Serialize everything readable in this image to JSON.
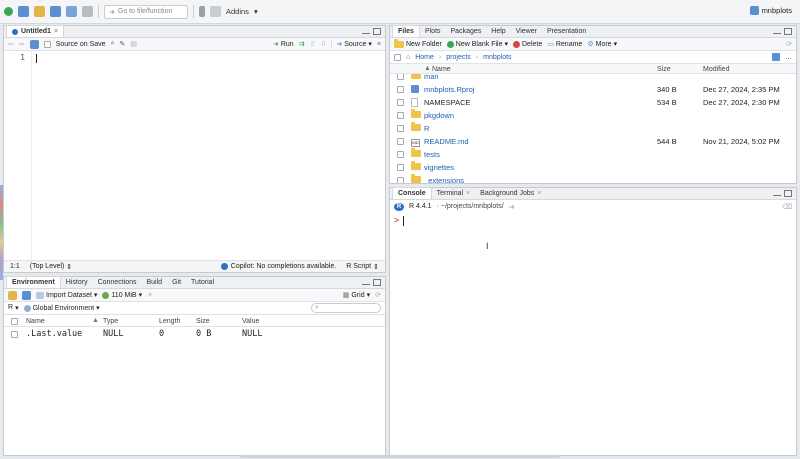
{
  "toolbar": {
    "goto_placeholder": "Go to file/function",
    "addins_label": "Addins",
    "project_label": "mnbplots"
  },
  "editor": {
    "tab_label": "Untitled1",
    "source_on_save_label": "Source on Save",
    "run_label": "Run",
    "source_label": "Source",
    "line_number": "1",
    "cursor_pos": "1:1",
    "scope": "(Top Level)",
    "copilot_status": "Copilot: No completions available.",
    "file_type": "R Script"
  },
  "env_pane": {
    "tabs": [
      "Environment",
      "History",
      "Connections",
      "Build",
      "Git",
      "Tutorial"
    ],
    "import_label": "Import Dataset",
    "memory_label": "110 MiB",
    "grid_label": "Grid",
    "lang_label": "R",
    "env_label": "Global Environment",
    "columns": [
      "Name",
      "Type",
      "Length",
      "Size",
      "Value"
    ],
    "rows": [
      {
        "name": ".Last.value",
        "type": "NULL",
        "length": "0",
        "size": "0 B",
        "value": "NULL"
      }
    ]
  },
  "files_pane": {
    "tabs": [
      "Files",
      "Plots",
      "Packages",
      "Help",
      "Viewer",
      "Presentation"
    ],
    "new_folder_label": "New Folder",
    "new_blank_file_label": "New Blank File",
    "delete_label": "Delete",
    "rename_label": "Rename",
    "more_label": "More",
    "breadcrumb": [
      "Home",
      "projects",
      "mnbplots"
    ],
    "columns": {
      "name": "Name",
      "size": "Size",
      "modified": "Modified"
    },
    "rows": [
      {
        "name": "man",
        "kind": "folder",
        "size": "",
        "modified": ""
      },
      {
        "name": "mnbplots.Rproj",
        "kind": "rproj",
        "size": "340 B",
        "modified": "Dec 27, 2024, 2:35 PM"
      },
      {
        "name": "NAMESPACE",
        "kind": "file",
        "size": "534 B",
        "modified": "Dec 27, 2024, 2:30 PM"
      },
      {
        "name": "pkgdown",
        "kind": "folder",
        "size": "",
        "modified": ""
      },
      {
        "name": "R",
        "kind": "folder",
        "size": "",
        "modified": ""
      },
      {
        "name": "README.md",
        "kind": "md",
        "size": "544 B",
        "modified": "Nov 21, 2024, 5:02 PM"
      },
      {
        "name": "tests",
        "kind": "folder",
        "size": "",
        "modified": ""
      },
      {
        "name": "vignettes",
        "kind": "folder",
        "size": "",
        "modified": ""
      },
      {
        "name": "_extensions",
        "kind": "folder",
        "size": "",
        "modified": ""
      }
    ]
  },
  "console_pane": {
    "tabs": [
      "Console",
      "Terminal",
      "Background Jobs"
    ],
    "r_version": "R 4.4.1",
    "path": "· ~/projects/mnbplots/",
    "prompt": ">"
  }
}
